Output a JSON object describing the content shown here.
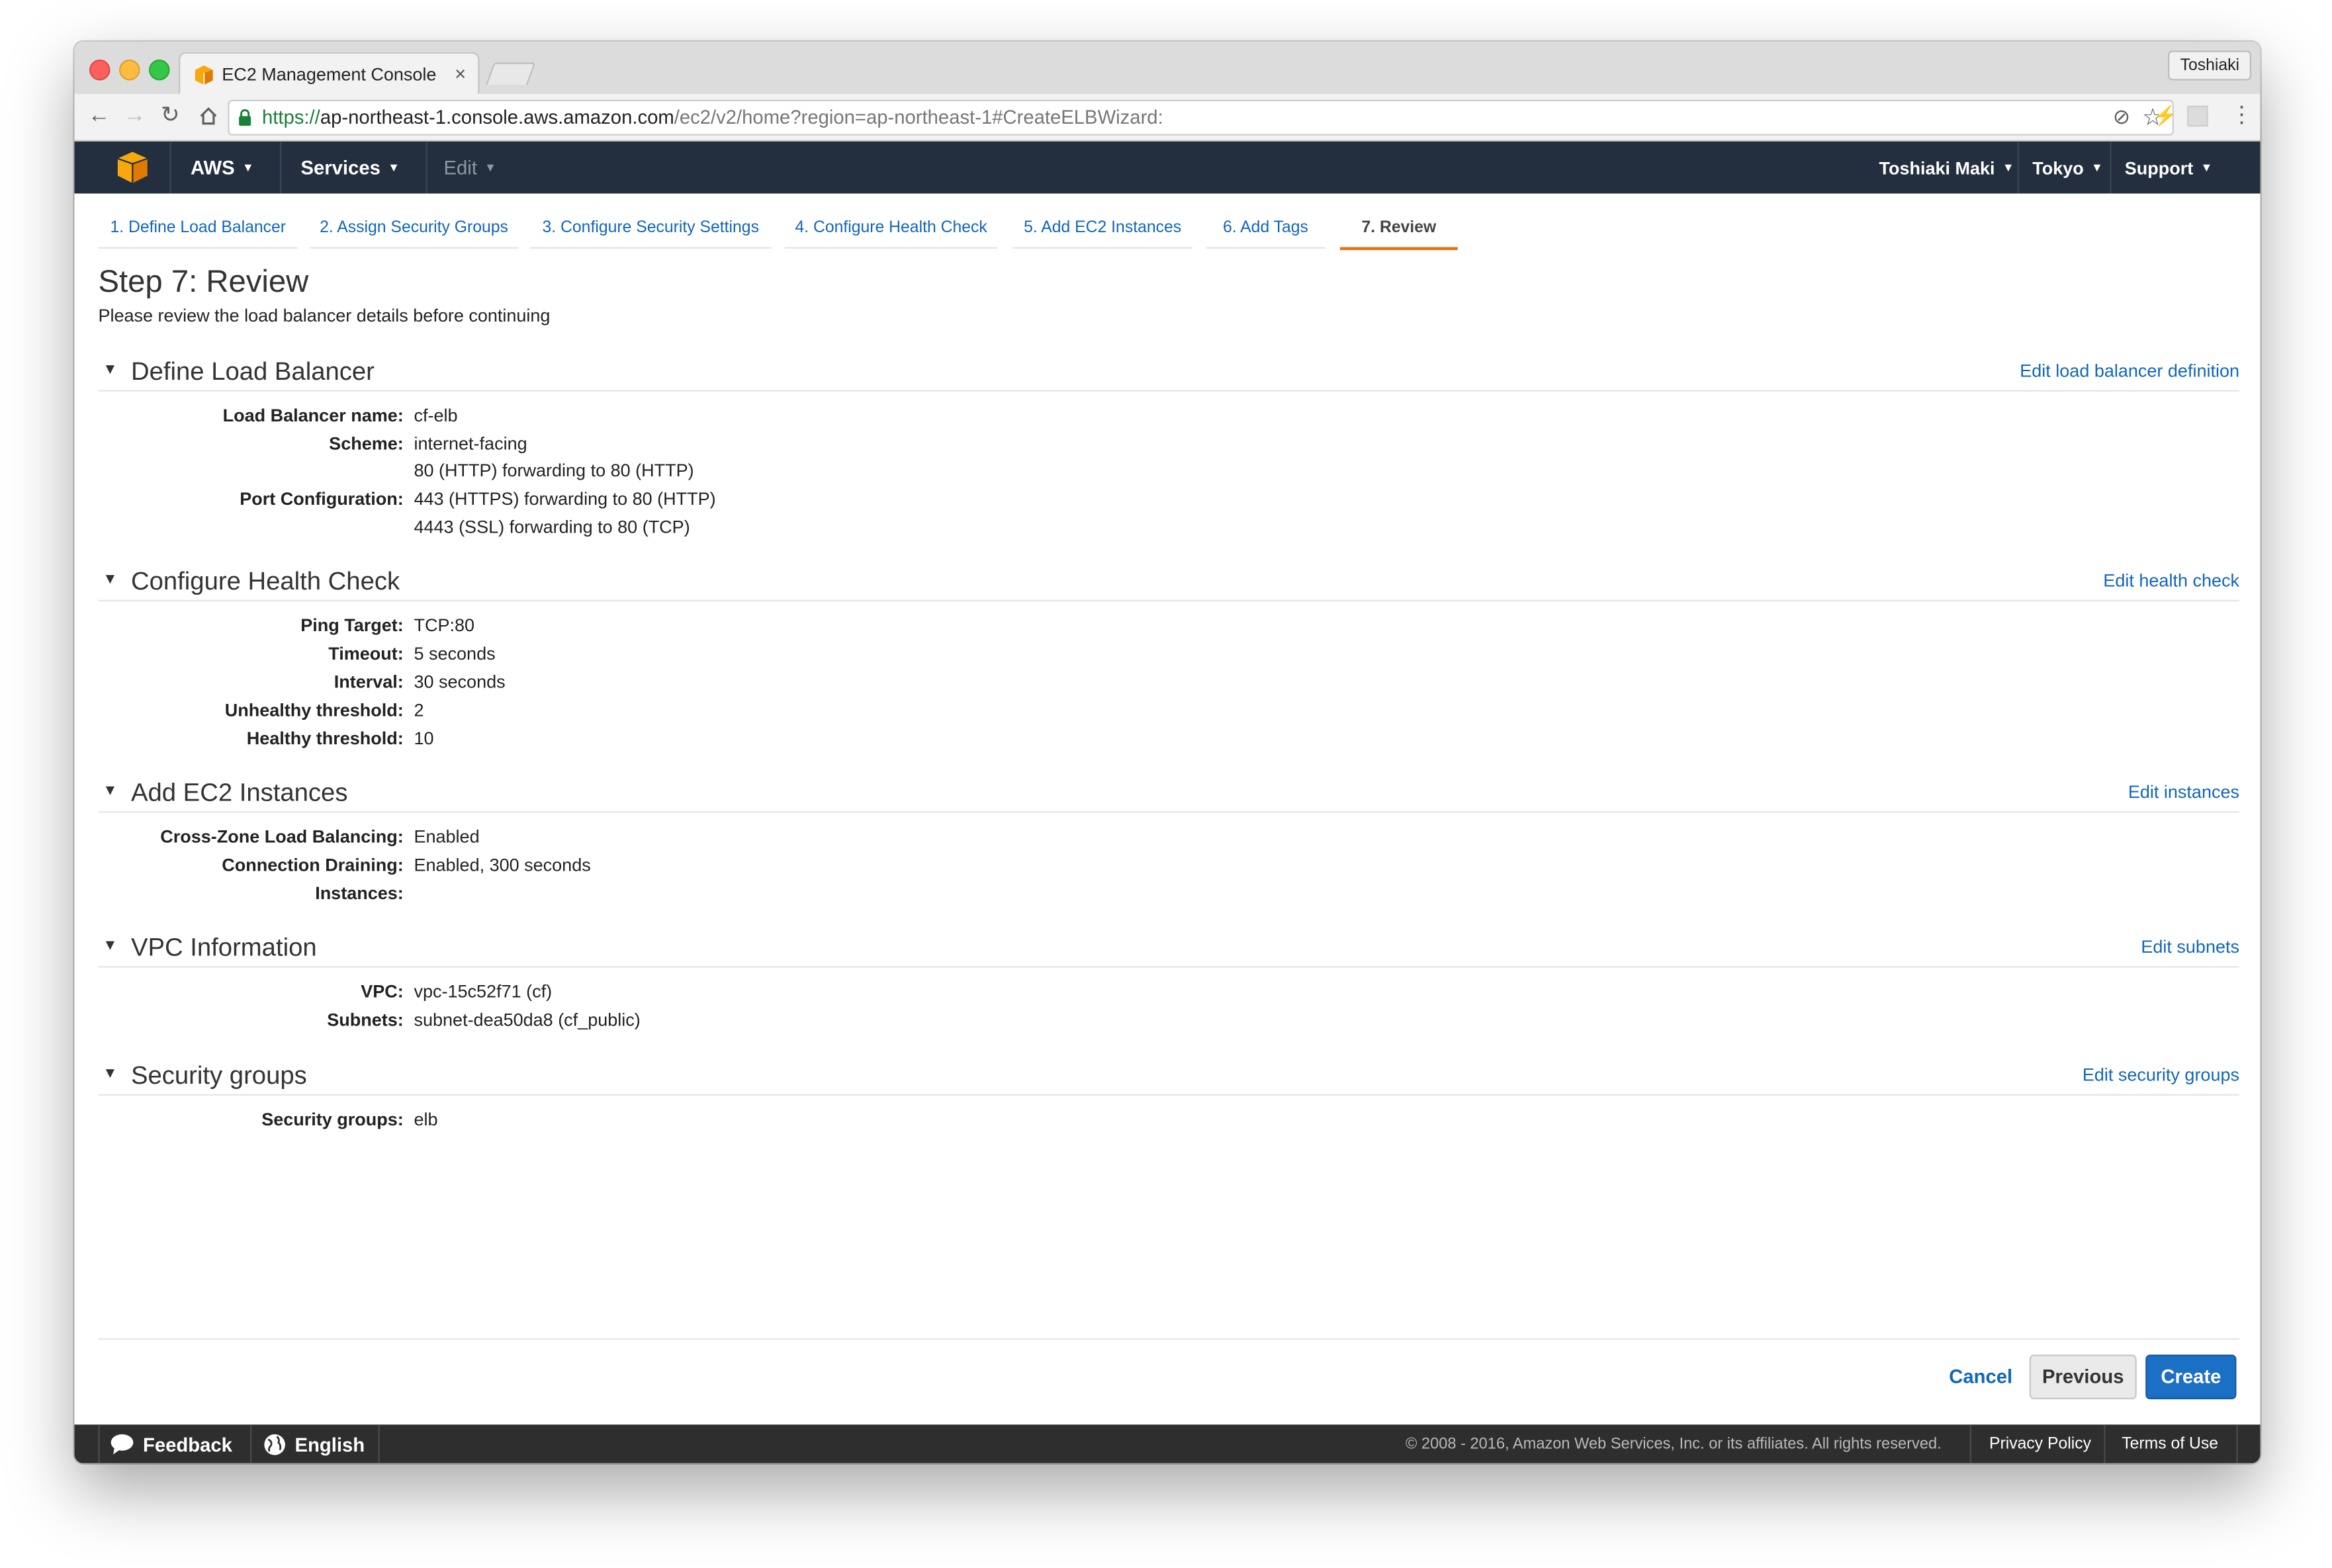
{
  "browser": {
    "tab_title": "EC2 Management Console",
    "profile": "Toshiaki",
    "url_scheme": "https://",
    "url_host": "ap-northeast-1.console.aws.amazon.com",
    "url_path": "/ec2/v2/home?region=ap-northeast-1#CreateELBWizard:"
  },
  "aws_nav": {
    "brand": "AWS",
    "services": "Services",
    "edit": "Edit",
    "user": "Toshiaki Maki",
    "region": "Tokyo",
    "support": "Support"
  },
  "wizard": {
    "steps": [
      "1. Define Load Balancer",
      "2. Assign Security Groups",
      "3. Configure Security Settings",
      "4. Configure Health Check",
      "5. Add EC2 Instances",
      "6. Add Tags",
      "7. Review"
    ],
    "active_step": "7. Review"
  },
  "page": {
    "title": "Step 7: Review",
    "subtitle": "Please review the load balancer details before continuing"
  },
  "sections": {
    "define_lb": {
      "title": "Define Load Balancer",
      "edit_link": "Edit load balancer definition",
      "rows": [
        {
          "label": "Load Balancer name:",
          "value": "cf-elb"
        },
        {
          "label": "Scheme:",
          "value": "internet-facing"
        },
        {
          "label": "",
          "value": "80 (HTTP) forwarding to 80 (HTTP)"
        },
        {
          "label": "Port Configuration:",
          "value": "443 (HTTPS) forwarding to 80 (HTTP)"
        },
        {
          "label": "",
          "value": "4443 (SSL) forwarding to 80 (TCP)"
        }
      ]
    },
    "health_check": {
      "title": "Configure Health Check",
      "edit_link": "Edit health check",
      "rows": [
        {
          "label": "Ping Target:",
          "value": "TCP:80"
        },
        {
          "label": "Timeout:",
          "value": "5 seconds"
        },
        {
          "label": "Interval:",
          "value": "30 seconds"
        },
        {
          "label": "Unhealthy threshold:",
          "value": "2"
        },
        {
          "label": "Healthy threshold:",
          "value": "10"
        }
      ]
    },
    "instances": {
      "title": "Add EC2 Instances",
      "edit_link": "Edit instances",
      "rows": [
        {
          "label": "Cross-Zone Load Balancing:",
          "value": "Enabled"
        },
        {
          "label": "Connection Draining:",
          "value": "Enabled, 300 seconds"
        },
        {
          "label": "Instances:",
          "value": ""
        }
      ]
    },
    "vpc": {
      "title": "VPC Information",
      "edit_link": "Edit subnets",
      "rows": [
        {
          "label": "VPC:",
          "value": "vpc-15c52f71 (cf)"
        },
        {
          "label": "Subnets:",
          "value": "subnet-dea50da8 (cf_public)"
        }
      ]
    },
    "security": {
      "title": "Security groups",
      "edit_link": "Edit security groups",
      "rows": [
        {
          "label": "Security groups:",
          "value": "elb"
        }
      ]
    }
  },
  "actions": {
    "cancel": "Cancel",
    "previous": "Previous",
    "create": "Create"
  },
  "footer": {
    "feedback": "Feedback",
    "language": "English",
    "copyright": "© 2008 - 2016, Amazon Web Services, Inc. or its affiliates. All rights reserved.",
    "privacy": "Privacy Policy",
    "terms": "Terms of Use"
  },
  "colors": {
    "nav_bg": "#232f3e",
    "link": "#1166bb",
    "active_step_underline": "#ec7211",
    "create_button": "#1b6fc4",
    "footer_bg": "#2e2e2e"
  },
  "icons": {
    "tab": "aws-cube-icon",
    "toolbar": [
      "back-icon",
      "forward-icon",
      "reload-icon",
      "home-icon",
      "lock-icon",
      "star-icon",
      "extension-icon",
      "menu-icon"
    ],
    "section": "collapse-arrow-icon",
    "footer": [
      "speech-bubble-icon",
      "globe-icon"
    ]
  }
}
